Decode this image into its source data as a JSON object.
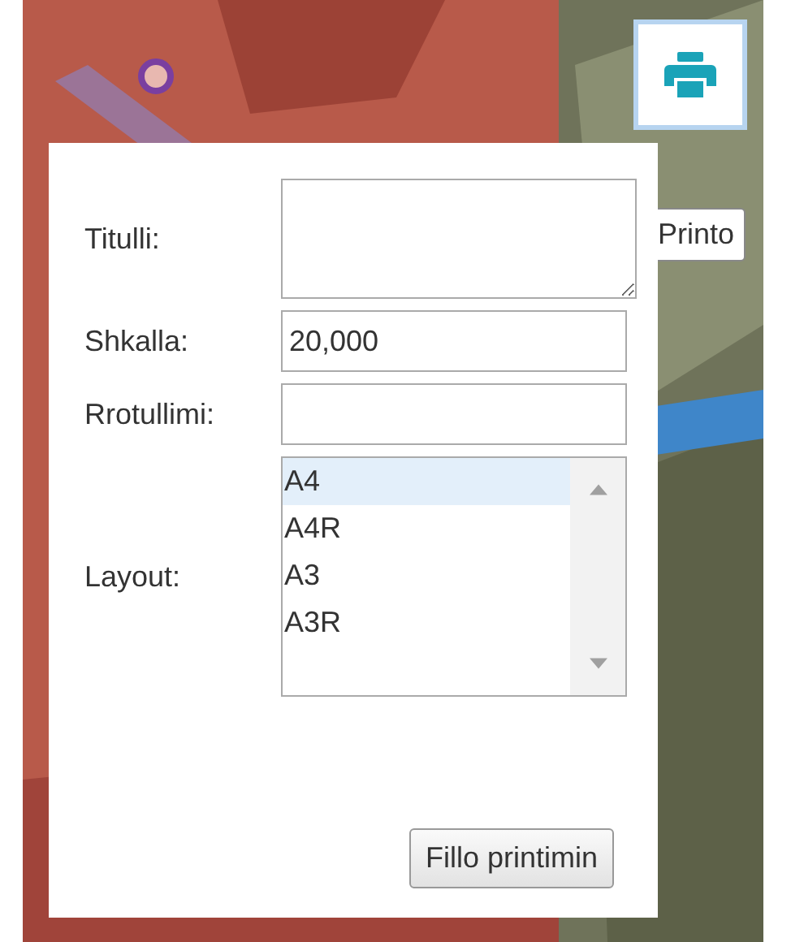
{
  "print_button": {
    "tooltip": "Printo"
  },
  "print_panel": {
    "fields": [
      {
        "kind": "textarea",
        "label": "Titulli:"
      },
      {
        "kind": "input",
        "label": "Shkalla:",
        "value": "20,000"
      },
      {
        "kind": "input",
        "label": "Rrotullimi:"
      },
      {
        "kind": "list",
        "label": "Layout:",
        "options": [
          {
            "label": "A4",
            "selected": true
          },
          {
            "label": "A4R",
            "selected": false
          },
          {
            "label": "A3",
            "selected": false
          },
          {
            "label": "A3R",
            "selected": false
          }
        ]
      }
    ],
    "submit_button": "Fillo printimin"
  }
}
